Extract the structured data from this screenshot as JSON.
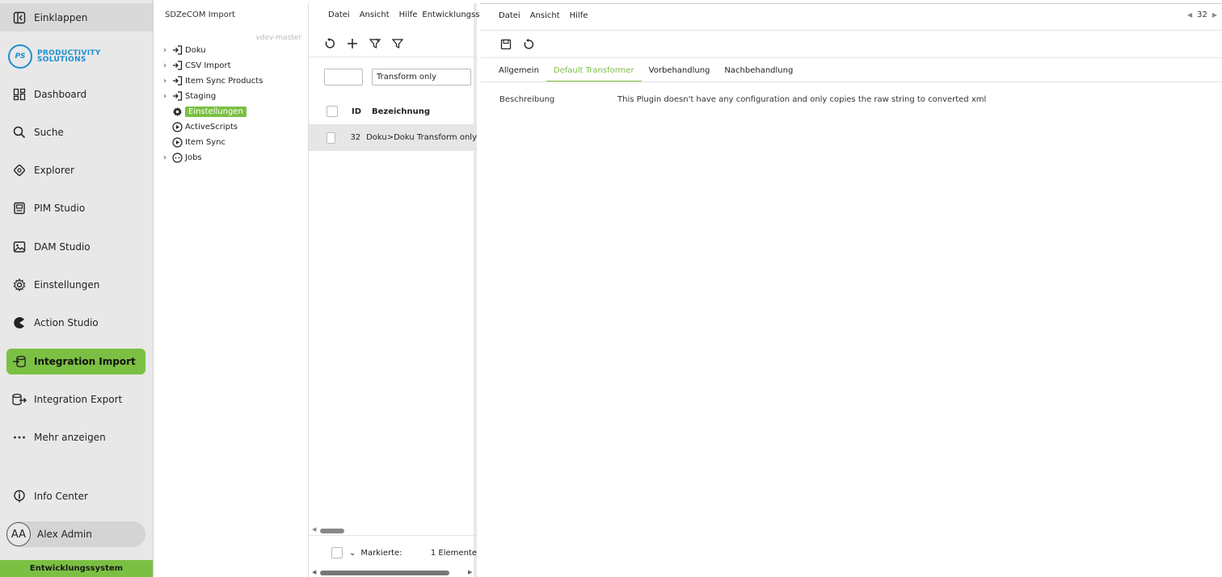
{
  "nav": {
    "collapse_label": "Einklappen",
    "logo": {
      "initials": "PS",
      "line1": "PRODUCTIVITY",
      "line2": "SOLUTIONS"
    },
    "items": [
      {
        "label": "Dashboard",
        "icon": "dashboard-icon"
      },
      {
        "label": "Suche",
        "icon": "search-icon"
      },
      {
        "label": "Explorer",
        "icon": "explorer-icon"
      },
      {
        "label": "PIM Studio",
        "icon": "pim-icon"
      },
      {
        "label": "DAM Studio",
        "icon": "image-icon"
      },
      {
        "label": "Einstellungen",
        "icon": "gear-icon"
      },
      {
        "label": "Action Studio",
        "icon": "action-icon"
      },
      {
        "label": "Integration Import",
        "icon": "import-icon",
        "active": true
      },
      {
        "label": "Integration Export",
        "icon": "export-icon"
      },
      {
        "label": "Mehr anzeigen",
        "icon": "more-icon"
      }
    ],
    "info_center": "Info Center",
    "user": {
      "initials": "AA",
      "name": "Alex Admin"
    },
    "environment": "Entwicklungssystem",
    "accent": "#7bc043"
  },
  "tree": {
    "title": "SDZeCOM Import",
    "branch": "vdev-master",
    "items": [
      {
        "label": "Doku",
        "expandable": true,
        "icon": "import-icon"
      },
      {
        "label": "CSV Import",
        "expandable": true,
        "icon": "import-icon"
      },
      {
        "label": "Item Sync Products",
        "expandable": true,
        "icon": "import-icon"
      },
      {
        "label": "Staging",
        "expandable": true,
        "icon": "import-icon"
      },
      {
        "label": "Einstellungen",
        "expandable": false,
        "icon": "gear-icon",
        "selected": true
      },
      {
        "label": "ActiveScripts",
        "expandable": false,
        "icon": "play-icon"
      },
      {
        "label": "Item Sync",
        "expandable": false,
        "icon": "play-icon"
      },
      {
        "label": "Jobs",
        "expandable": true,
        "icon": "jobs-icon"
      }
    ]
  },
  "list": {
    "menu": [
      "Datei",
      "Ansicht",
      "Hilfe",
      "Entwicklungssyste"
    ],
    "filter_id": "",
    "filter_name": "Transform only",
    "columns": {
      "id": "ID",
      "name": "Bezeichnung"
    },
    "rows": [
      {
        "id": "32",
        "name": "Doku>Doku Transform only"
      }
    ],
    "footer": {
      "marked": "Markierte:",
      "count": "1 Elemente"
    }
  },
  "detail": {
    "menu": [
      "Datei",
      "Ansicht",
      "Hilfe"
    ],
    "pager_value": "32",
    "tabs": [
      "Allgemein",
      "Default Transformer",
      "Vorbehandlung",
      "Nachbehandlung"
    ],
    "active_tab": 1,
    "field": {
      "label": "Beschreibung",
      "value": "This Plugin doesn't have any configuration and only copies the raw string to converted xml"
    }
  }
}
